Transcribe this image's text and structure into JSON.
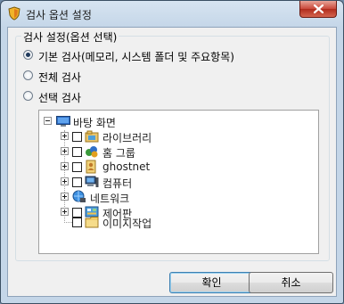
{
  "window": {
    "title": "검사 옵션 설정",
    "close_icon": "close-icon"
  },
  "group": {
    "title": "검사 설정(옵션 선택)"
  },
  "radios": [
    {
      "label": "기본 검사(메모리, 시스템 폴더 및 주요항목)",
      "checked": true
    },
    {
      "label": "전체 검사",
      "checked": false
    },
    {
      "label": "선택 검사",
      "checked": false
    }
  ],
  "tree": {
    "root": {
      "label": "바탕 화면",
      "icon": "desktop-icon"
    },
    "items": [
      {
        "label": "라이브러리",
        "icon": "library-icon"
      },
      {
        "label": "홈 그룹",
        "icon": "homegroup-icon"
      },
      {
        "label": "ghostnet",
        "icon": "user-folder-icon"
      },
      {
        "label": "컴퓨터",
        "icon": "computer-icon"
      },
      {
        "label": "네트워크",
        "icon": "network-icon"
      },
      {
        "label": "제어판",
        "icon": "control-panel-icon"
      },
      {
        "label": "이미지작업",
        "icon": "folder-icon"
      }
    ]
  },
  "buttons": {
    "ok": "확인",
    "cancel": "취소"
  }
}
